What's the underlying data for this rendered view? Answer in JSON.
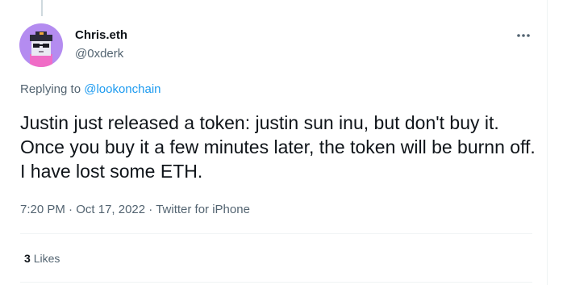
{
  "tweet": {
    "author": {
      "display_name": "Chris.eth",
      "handle": "@0xderk",
      "avatar_icon": "pixel-art-avatar"
    },
    "more_icon": "more-dots-icon",
    "reply_prefix": "Replying to",
    "reply_to": "@lookonchain",
    "text": "Justin just released a token: justin sun inu, but don't buy it. Once you buy it a few minutes later, the token will be burnn off. I have lost some ETH.",
    "time": "7:20 PM",
    "date": "Oct 17, 2022",
    "source": "Twitter for iPhone",
    "separator": "·",
    "likes_count": "3",
    "likes_label": "Likes"
  },
  "colors": {
    "text_primary": "#0f1419",
    "text_secondary": "#536471",
    "link": "#1d9bf0",
    "avatar_bg": "#b48cf0"
  }
}
